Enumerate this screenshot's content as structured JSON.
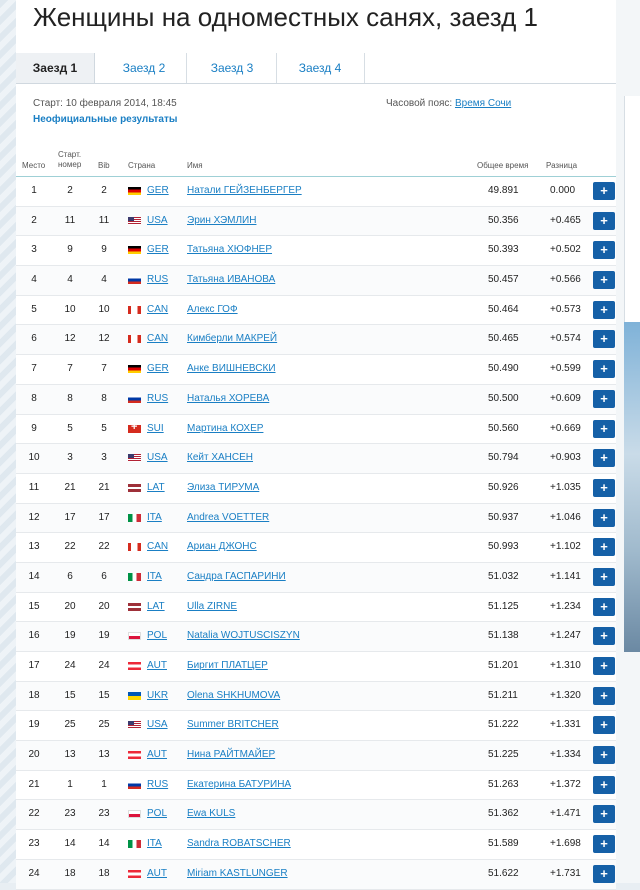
{
  "page": {
    "title": "Женщины на одноместных санях, заезд 1",
    "tabs": [
      {
        "label": "Заезд 1",
        "active": true
      },
      {
        "label": "Заезд 2",
        "active": false
      },
      {
        "label": "Заезд 3",
        "active": false
      },
      {
        "label": "Заезд 4",
        "active": false
      }
    ],
    "start_label": "Старт: 10 февраля 2014, 18:45",
    "timezone_label": "Часовой пояс:",
    "timezone_value": "Время Сочи",
    "unofficial": "Неофициальные результаты"
  },
  "table": {
    "headers": {
      "place": "Место",
      "start_no_1": "Старт.",
      "start_no_2": "номер",
      "bib": "Bib",
      "country": "Страна",
      "name": "Имя",
      "total": "Общее время",
      "diff": "Разница"
    },
    "rows": [
      {
        "place": "1",
        "start": "2",
        "bib": "2",
        "noc": "GER",
        "name": "Натали ГЕЙЗЕНБЕРГЕР",
        "time": "49.891",
        "diff": "0.000"
      },
      {
        "place": "2",
        "start": "11",
        "bib": "11",
        "noc": "USA",
        "name": "Эрин ХЭМЛИН",
        "time": "50.356",
        "diff": "+0.465"
      },
      {
        "place": "3",
        "start": "9",
        "bib": "9",
        "noc": "GER",
        "name": "Татьяна ХЮФНЕР",
        "time": "50.393",
        "diff": "+0.502"
      },
      {
        "place": "4",
        "start": "4",
        "bib": "4",
        "noc": "RUS",
        "name": "Татьяна ИВАНОВА",
        "time": "50.457",
        "diff": "+0.566"
      },
      {
        "place": "5",
        "start": "10",
        "bib": "10",
        "noc": "CAN",
        "name": "Алекс ГОФ",
        "time": "50.464",
        "diff": "+0.573"
      },
      {
        "place": "6",
        "start": "12",
        "bib": "12",
        "noc": "CAN",
        "name": "Кимберли МАКРЕЙ",
        "time": "50.465",
        "diff": "+0.574"
      },
      {
        "place": "7",
        "start": "7",
        "bib": "7",
        "noc": "GER",
        "name": "Анке ВИШНЕВСКИ",
        "time": "50.490",
        "diff": "+0.599"
      },
      {
        "place": "8",
        "start": "8",
        "bib": "8",
        "noc": "RUS",
        "name": "Наталья ХОРЕВА",
        "time": "50.500",
        "diff": "+0.609"
      },
      {
        "place": "9",
        "start": "5",
        "bib": "5",
        "noc": "SUI",
        "name": "Мартина КОХЕР",
        "time": "50.560",
        "diff": "+0.669"
      },
      {
        "place": "10",
        "start": "3",
        "bib": "3",
        "noc": "USA",
        "name": "Кейт ХАНСЕН",
        "time": "50.794",
        "diff": "+0.903"
      },
      {
        "place": "11",
        "start": "21",
        "bib": "21",
        "noc": "LAT",
        "name": "Элиза ТИРУМА",
        "time": "50.926",
        "diff": "+1.035"
      },
      {
        "place": "12",
        "start": "17",
        "bib": "17",
        "noc": "ITA",
        "name": "Andrea VOETTER",
        "time": "50.937",
        "diff": "+1.046"
      },
      {
        "place": "13",
        "start": "22",
        "bib": "22",
        "noc": "CAN",
        "name": "Ариан ДЖОНС",
        "time": "50.993",
        "diff": "+1.102"
      },
      {
        "place": "14",
        "start": "6",
        "bib": "6",
        "noc": "ITA",
        "name": "Сандра ГАСПАРИНИ",
        "time": "51.032",
        "diff": "+1.141"
      },
      {
        "place": "15",
        "start": "20",
        "bib": "20",
        "noc": "LAT",
        "name": "Ulla ZIRNE",
        "time": "51.125",
        "diff": "+1.234"
      },
      {
        "place": "16",
        "start": "19",
        "bib": "19",
        "noc": "POL",
        "name": "Natalia WOJTUSCISZYN",
        "time": "51.138",
        "diff": "+1.247"
      },
      {
        "place": "17",
        "start": "24",
        "bib": "24",
        "noc": "AUT",
        "name": "Биргит ПЛАТЦЕР",
        "time": "51.201",
        "diff": "+1.310"
      },
      {
        "place": "18",
        "start": "15",
        "bib": "15",
        "noc": "UKR",
        "name": "Olena SHKHUMOVA",
        "time": "51.211",
        "diff": "+1.320"
      },
      {
        "place": "19",
        "start": "25",
        "bib": "25",
        "noc": "USA",
        "name": "Summer BRITCHER",
        "time": "51.222",
        "diff": "+1.331"
      },
      {
        "place": "20",
        "start": "13",
        "bib": "13",
        "noc": "AUT",
        "name": "Нина РАЙТМАЙЕР",
        "time": "51.225",
        "diff": "+1.334"
      },
      {
        "place": "21",
        "start": "1",
        "bib": "1",
        "noc": "RUS",
        "name": "Екатерина БАТУРИНА",
        "time": "51.263",
        "diff": "+1.372"
      },
      {
        "place": "22",
        "start": "23",
        "bib": "23",
        "noc": "POL",
        "name": "Ewa KULS",
        "time": "51.362",
        "diff": "+1.471"
      },
      {
        "place": "23",
        "start": "14",
        "bib": "14",
        "noc": "ITA",
        "name": "Sandra ROBATSCHER",
        "time": "51.589",
        "diff": "+1.698"
      },
      {
        "place": "24",
        "start": "18",
        "bib": "18",
        "noc": "AUT",
        "name": "Miriam KASTLUNGER",
        "time": "51.622",
        "diff": "+1.731"
      }
    ],
    "expand_label": "+"
  }
}
